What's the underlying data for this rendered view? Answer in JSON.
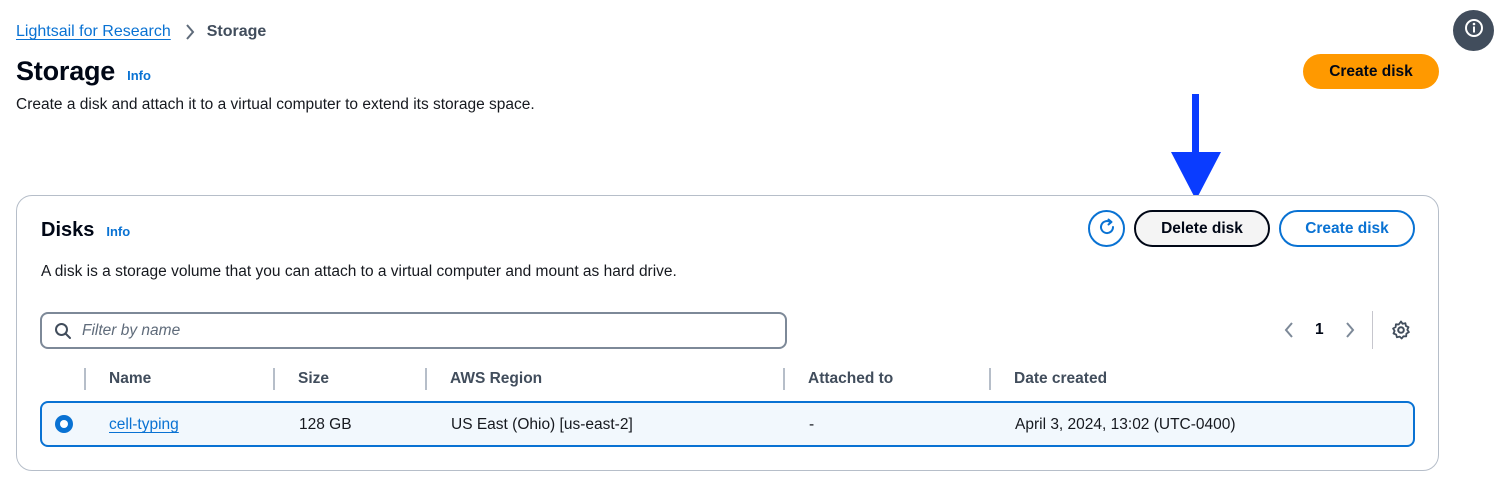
{
  "breadcrumb": {
    "root": "Lightsail for Research",
    "current": "Storage"
  },
  "header": {
    "title": "Storage",
    "info": "Info",
    "description": "Create a disk and attach it to a virtual computer to extend its storage space.",
    "create_button": "Create disk"
  },
  "disks": {
    "title": "Disks",
    "info": "Info",
    "description": "A disk is a storage volume that you can attach to a virtual computer and mount as hard drive.",
    "delete_button": "Delete disk",
    "create_button": "Create disk",
    "filter_placeholder": "Filter by name",
    "page": "1",
    "columns": [
      "Name",
      "Size",
      "AWS Region",
      "Attached to",
      "Date created"
    ],
    "rows": [
      {
        "name": "cell-typing",
        "size": "128 GB",
        "region": "US East (Ohio) [us-east-2]",
        "attached_to": "-",
        "date_created": "April 3, 2024, 13:02 (UTC-0400)",
        "selected": true
      }
    ]
  },
  "colors": {
    "primary_button": "#ff9900",
    "link": "#0972d3",
    "selected_row_bg": "#f2f8fd",
    "annotation_arrow": "#0a3cff"
  },
  "icons": {
    "help": "info-circle-icon",
    "refresh": "refresh-icon",
    "search": "search-icon",
    "prev": "chevron-left-icon",
    "next": "chevron-right-icon",
    "settings": "gear-icon",
    "separator": "chevron-right-icon"
  }
}
